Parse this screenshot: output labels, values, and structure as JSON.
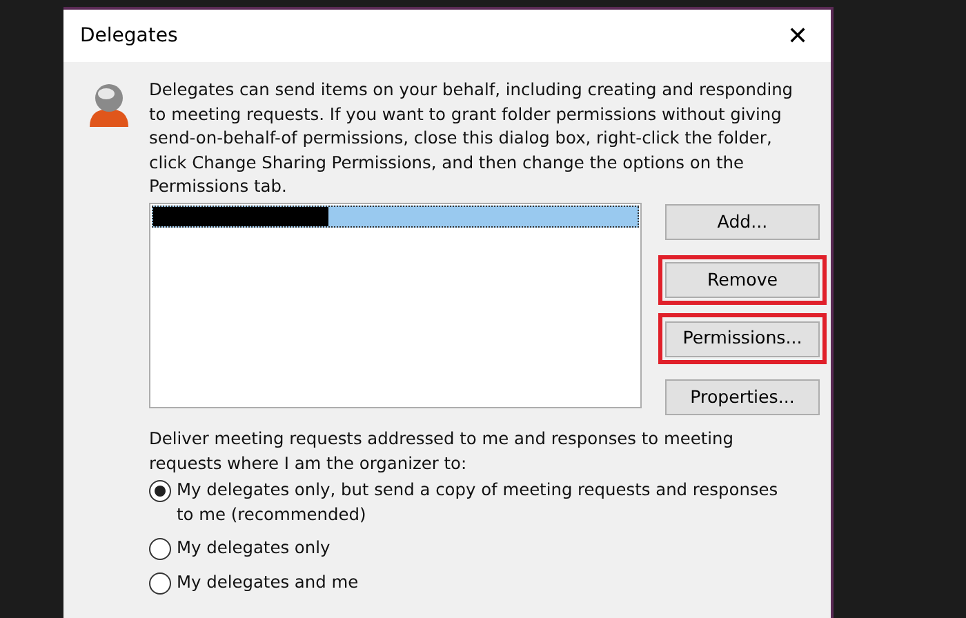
{
  "window": {
    "title": "Delegates",
    "close": "✕"
  },
  "intro": "Delegates can send items on your behalf, including creating and responding to meeting requests. If you want to grant folder permissions without giving send-on-behalf-of permissions, close this dialog box, right-click the folder, click Change Sharing Permissions, and then change the options on the Permissions tab.",
  "delegates": [
    {
      "selected": true,
      "redacted": true
    }
  ],
  "buttons": [
    {
      "label": "Add...",
      "highlighted": false
    },
    {
      "label": "Remove",
      "highlighted": true
    },
    {
      "label": "Permissions...",
      "highlighted": true
    },
    {
      "label": "Properties...",
      "highlighted": false
    }
  ],
  "deliver": {
    "label": "Deliver meeting requests addressed to me and responses to meeting requests where I am the organizer to:",
    "options": [
      {
        "label": "My delegates only, but send a copy of meeting requests and responses to me (recommended)",
        "selected": true
      },
      {
        "label": "My delegates only",
        "selected": false
      },
      {
        "label": "My delegates and me",
        "selected": false
      }
    ]
  }
}
